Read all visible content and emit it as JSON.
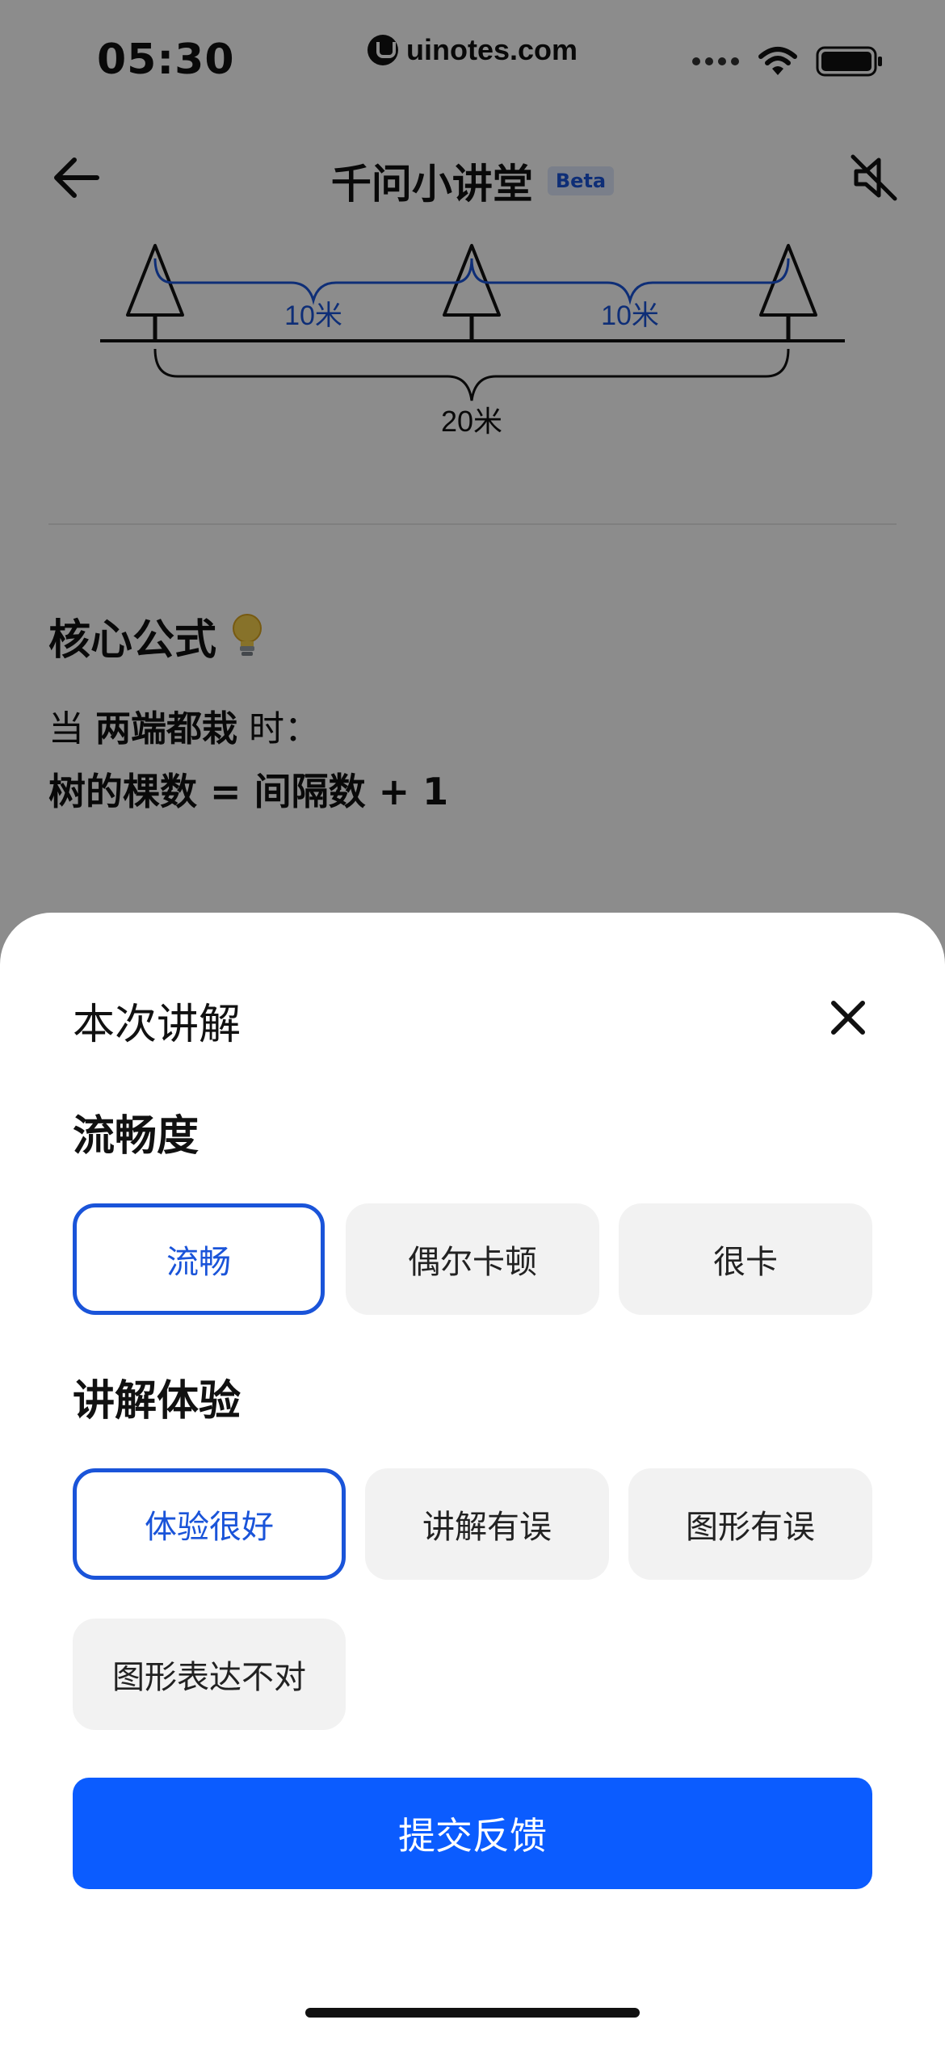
{
  "status_bar": {
    "time": "05:30",
    "watermark": "uinotes.com"
  },
  "nav": {
    "title": "千问小讲堂",
    "badge": "Beta"
  },
  "diagram": {
    "gap_label_1": "10米",
    "gap_label_2": "10米",
    "total_label": "20米",
    "line_color": "#1a54d9"
  },
  "formula": {
    "title": "核心公式",
    "line1_prefix": "当",
    "line1_bold": "两端都栽",
    "line1_suffix": "时：",
    "line2": "树的棵数 = 间隔数 + 1"
  },
  "sheet": {
    "title": "本次讲解",
    "fluency": {
      "title": "流畅度",
      "options": [
        "流畅",
        "偶尔卡顿",
        "很卡"
      ],
      "selected": "流畅"
    },
    "experience": {
      "title": "讲解体验",
      "options": [
        "体验很好",
        "讲解有误",
        "图形有误",
        "图形表达不对"
      ],
      "selected": "体验很好"
    },
    "submit_label": "提交反馈"
  },
  "colors": {
    "accent": "#1a54d9",
    "submit": "#0b5cff",
    "option_bg": "#f2f2f2"
  }
}
